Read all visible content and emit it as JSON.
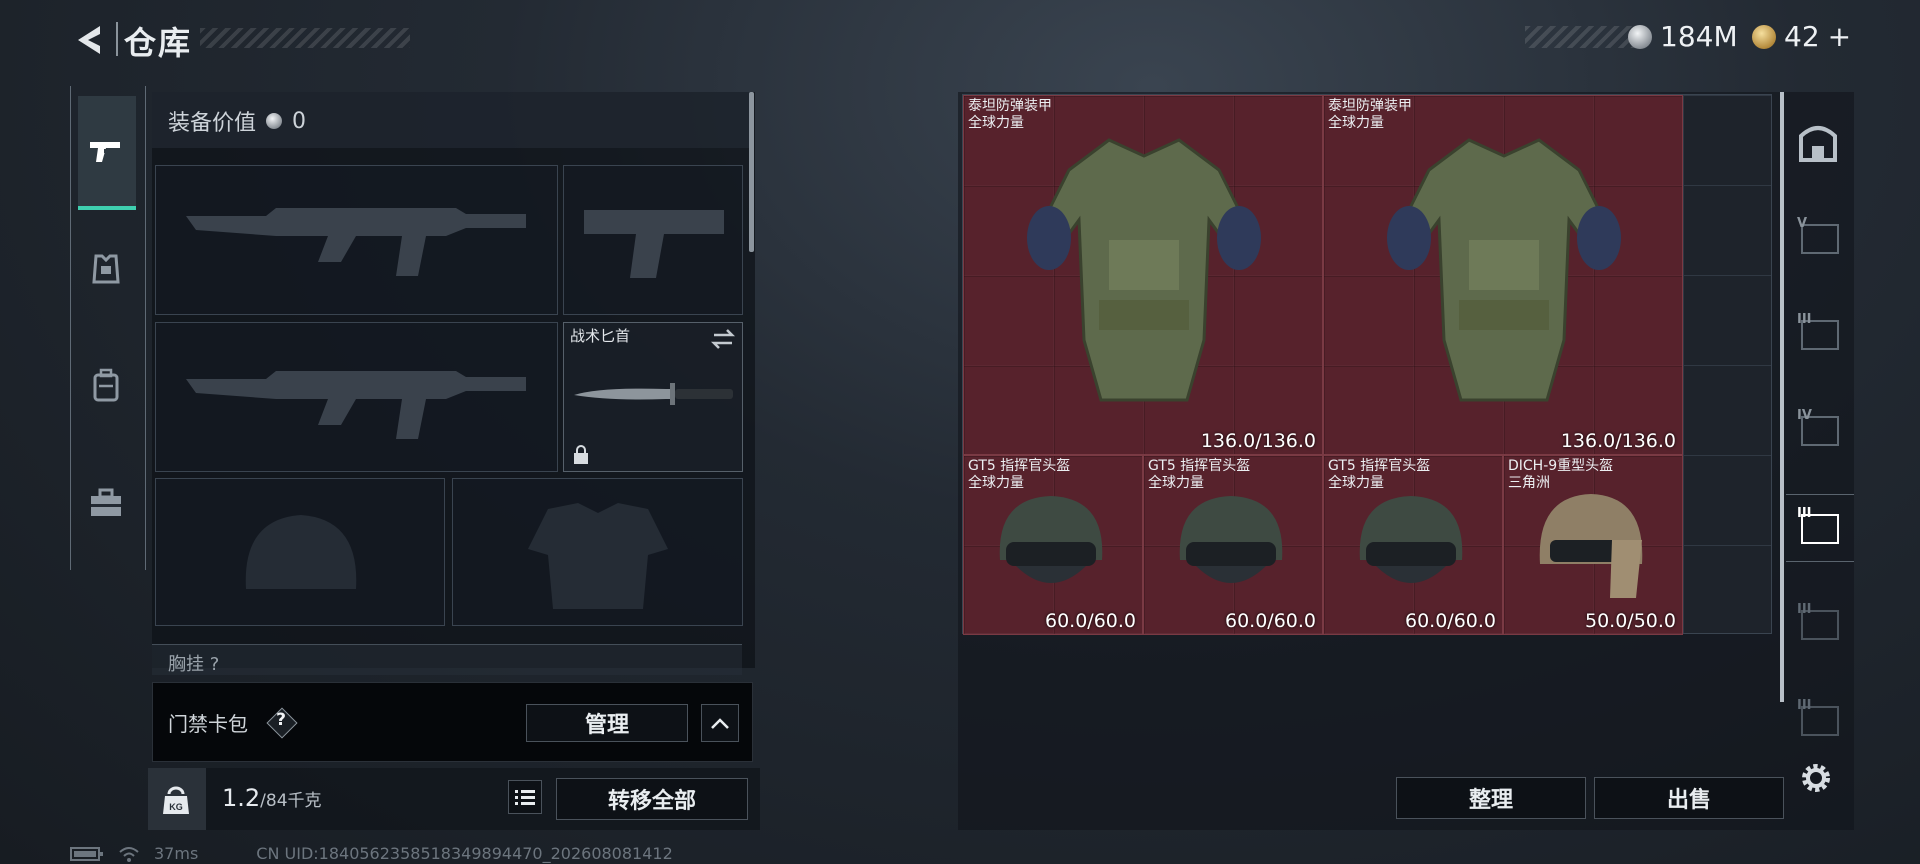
{
  "header": {
    "title": "仓库",
    "currencies": [
      {
        "icon": "silver-coin-icon",
        "value": "184M"
      },
      {
        "icon": "gold-coin-icon",
        "value": "42"
      }
    ],
    "add_symbol": "+"
  },
  "rail": {
    "items": [
      {
        "name": "weapons-tab",
        "icon": "pistol-icon",
        "selected": true
      },
      {
        "name": "armor-tab",
        "icon": "armor-vest-icon",
        "selected": false
      },
      {
        "name": "backpack-tab",
        "icon": "backpack-icon",
        "selected": false
      },
      {
        "name": "case-tab",
        "icon": "briefcase-icon",
        "selected": false
      }
    ]
  },
  "equipment": {
    "value_label": "装备价值",
    "value": "0",
    "melee_label": "战术匕首",
    "chest_label": "胸挂",
    "chest_count": "?"
  },
  "card_pack": {
    "label": "门禁卡包",
    "help": "?",
    "manage_label": "管理"
  },
  "inventory": {
    "weight_value": "1.2",
    "weight_max": "/84千克",
    "transfer_all_label": "转移全部"
  },
  "status_bar": {
    "ping": "37ms",
    "uid": "CN UID:1840562358518349894470_202608081412"
  },
  "stash": {
    "items": [
      {
        "name": "泰坦防弹装甲",
        "source": "全球力量",
        "durability": "136.0/136.0",
        "kind": "armor"
      },
      {
        "name": "泰坦防弹装甲",
        "source": "全球力量",
        "durability": "136.0/136.0",
        "kind": "armor"
      },
      {
        "name": "GT5 指挥官头盔",
        "source": "全球力量",
        "durability": "60.0/60.0",
        "kind": "helmet"
      },
      {
        "name": "GT5 指挥官头盔",
        "source": "全球力量",
        "durability": "60.0/60.0",
        "kind": "helmet"
      },
      {
        "name": "GT5 指挥官头盔",
        "source": "全球力量",
        "durability": "60.0/60.0",
        "kind": "helmet"
      },
      {
        "name": "DICH-9重型头盔",
        "source": "三角洲",
        "durability": "50.0/50.0",
        "kind": "helmet-tan"
      }
    ],
    "sort_label": "整理",
    "sell_label": "出售",
    "side_tabs": [
      "",
      "V",
      "III",
      "IV",
      "III",
      "III",
      "III"
    ]
  },
  "colors": {
    "accent": "#3fd0b0",
    "item_highlight": "#6e222c"
  }
}
